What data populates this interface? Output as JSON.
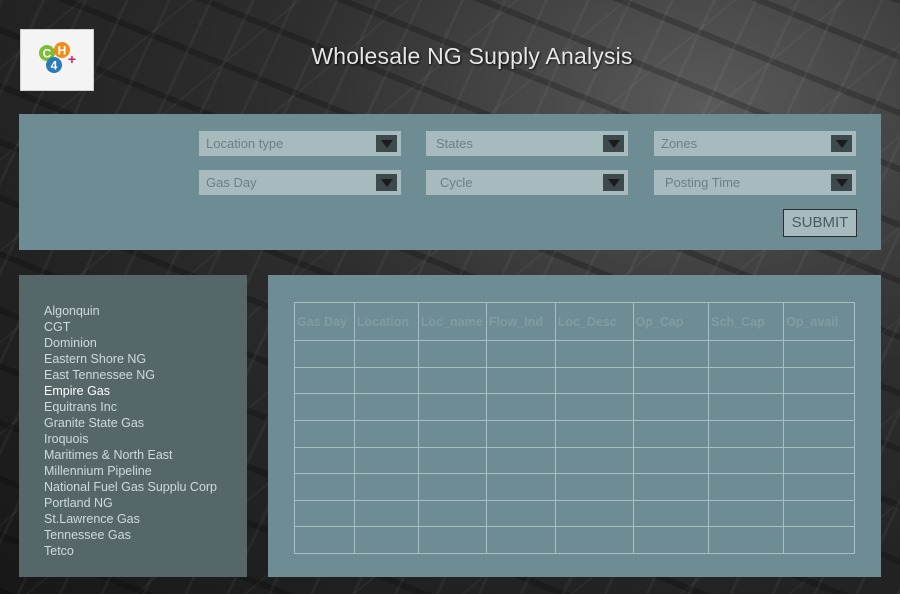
{
  "header": {
    "logo_text": "CH4+",
    "title": "Wholesale NG Supply Analysis"
  },
  "filters": {
    "location_type": "Location type",
    "states": "States",
    "zones": "Zones",
    "gas_day": "Gas Day",
    "cycle": "Cycle",
    "posting_time": "Posting Time",
    "submit_label": "SUBMIT"
  },
  "pipelines": {
    "items": [
      "Algonquin",
      "CGT",
      "Dominion",
      "Eastern Shore NG",
      "East Tennessee NG",
      "Empire Gas",
      "Equitrans Inc",
      "Granite State Gas",
      "Iroquois",
      "Maritimes & North East",
      "Millennium Pipeline",
      "National Fuel Gas Supplu Corp",
      "Portland NG",
      "St.Lawrence Gas",
      "Tennessee Gas",
      "Tetco"
    ],
    "active": "Empire Gas"
  },
  "table": {
    "columns": [
      "Gas Day",
      "Location",
      "Loc_name",
      "Flow_Ind",
      "Loc_Desc",
      "Op_Cap",
      "Sch_Cap",
      "Op_avail"
    ],
    "row_count": 8
  },
  "colors": {
    "panel": "#6e8c93",
    "sidebar": "#56676a",
    "select_bg": "#a7bbbf",
    "logo_blue": "#2a7ab8",
    "logo_green": "#7cbd34",
    "logo_orange": "#f08c1a",
    "logo_plus": "#d0216a"
  }
}
